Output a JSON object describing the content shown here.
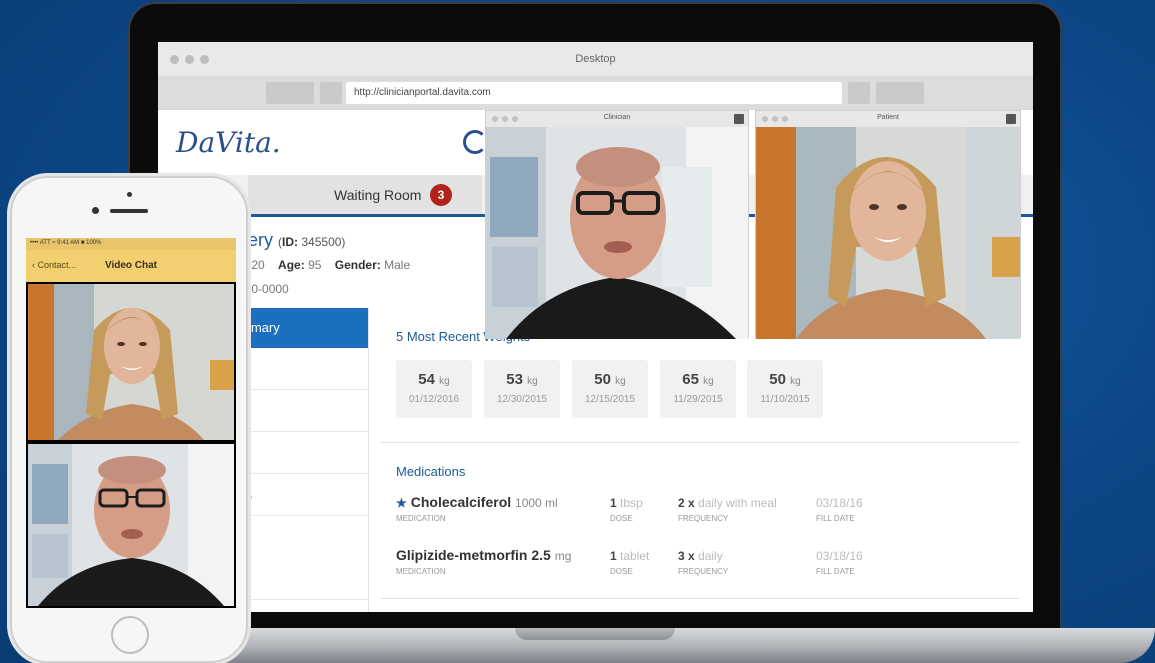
{
  "browser": {
    "title": "Desktop",
    "url": "http://clinicianportal.davita.com"
  },
  "portal": {
    "logo": "DaVita.",
    "tab_label": "Waiting Room",
    "tab_badge": "3"
  },
  "patient": {
    "name_fragment": "nery",
    "id_label": "ID:",
    "id_value": "345500",
    "dob_fragment": "1920",
    "age_label": "Age:",
    "age_value": "95",
    "gender_label": "Gender:",
    "gender_value": "Male",
    "phone_fragment": "000-0000"
  },
  "sidebar": {
    "active_item": "mmary",
    "items": [
      "",
      "",
      "",
      "s",
      ""
    ]
  },
  "weights": {
    "title": "5 Most Recent Weights",
    "entries": [
      {
        "value": "54",
        "unit": "kg",
        "date": "01/12/2016"
      },
      {
        "value": "53",
        "unit": "kg",
        "date": "12/30/2015"
      },
      {
        "value": "50",
        "unit": "kg",
        "date": "12/15/2015"
      },
      {
        "value": "65",
        "unit": "kg",
        "date": "11/29/2015"
      },
      {
        "value": "50",
        "unit": "kg",
        "date": "11/10/2015"
      }
    ]
  },
  "medications": {
    "title": "Medications",
    "rows": [
      {
        "starred": true,
        "name": "Cholecalciferol",
        "amount": "1000 ml",
        "type": "MEDICATION",
        "dose_num": "1",
        "dose_unit": "tbsp",
        "dose_label": "DOSE",
        "freq_num": "2 x",
        "freq_text": "daily with meal",
        "freq_label": "FREQUENCY",
        "fill_date": "03/18/16",
        "fill_label": "FILL DATE"
      },
      {
        "starred": false,
        "name": "Glipizide-metmorfin",
        "amount_num": "2.5",
        "amount_unit": "mg",
        "type": "MEDICATION",
        "dose_num": "1",
        "dose_unit": "tablet",
        "dose_label": "DOSE",
        "freq_num": "3 x",
        "freq_text": "daily",
        "freq_label": "FREQUENCY",
        "fill_date": "03/18/16",
        "fill_label": "FILL DATE"
      }
    ]
  },
  "video_windows": {
    "clinician_title": "Clinician",
    "patient_title": "Patient"
  },
  "phone": {
    "status": "•••• ATT  ≈   9:41 AM        ■ 100%",
    "back_label": "Contact...",
    "title": "Video Chat"
  },
  "colors": {
    "background": "#0d4a8a",
    "brand_blue": "#1a5a9c",
    "active_nav": "#1b6fbe",
    "badge_red": "#b3211b",
    "phone_nav": "#f2cf6f"
  }
}
